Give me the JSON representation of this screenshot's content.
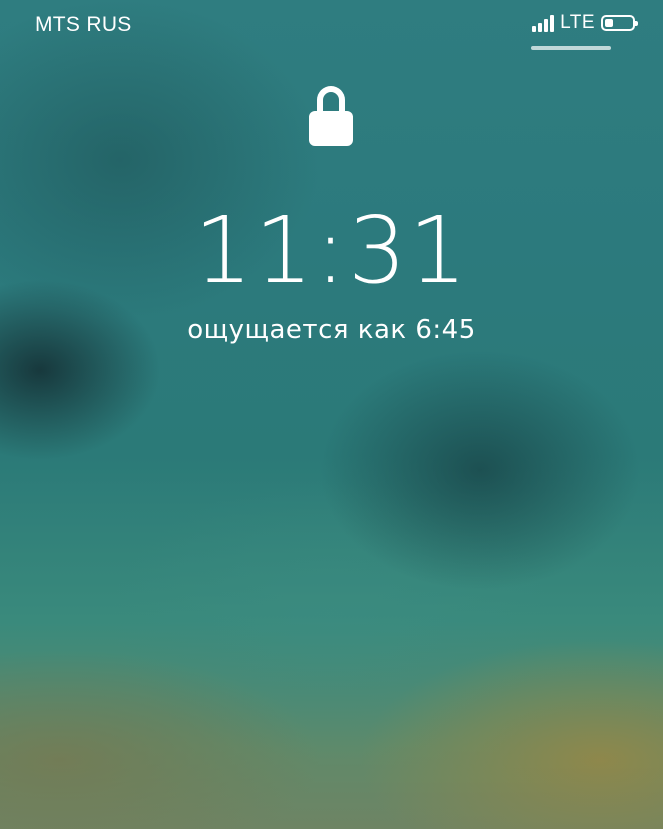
{
  "status_bar": {
    "carrier": "MTS RUS",
    "network": "LTE",
    "signal_bars": 4,
    "battery_level": 0.3,
    "icons": [
      "signal-icon",
      "battery-icon"
    ]
  },
  "lock_screen": {
    "lock_icon": "lock-icon",
    "time": "11:31",
    "subtitle": "ощущается как 6:45"
  }
}
